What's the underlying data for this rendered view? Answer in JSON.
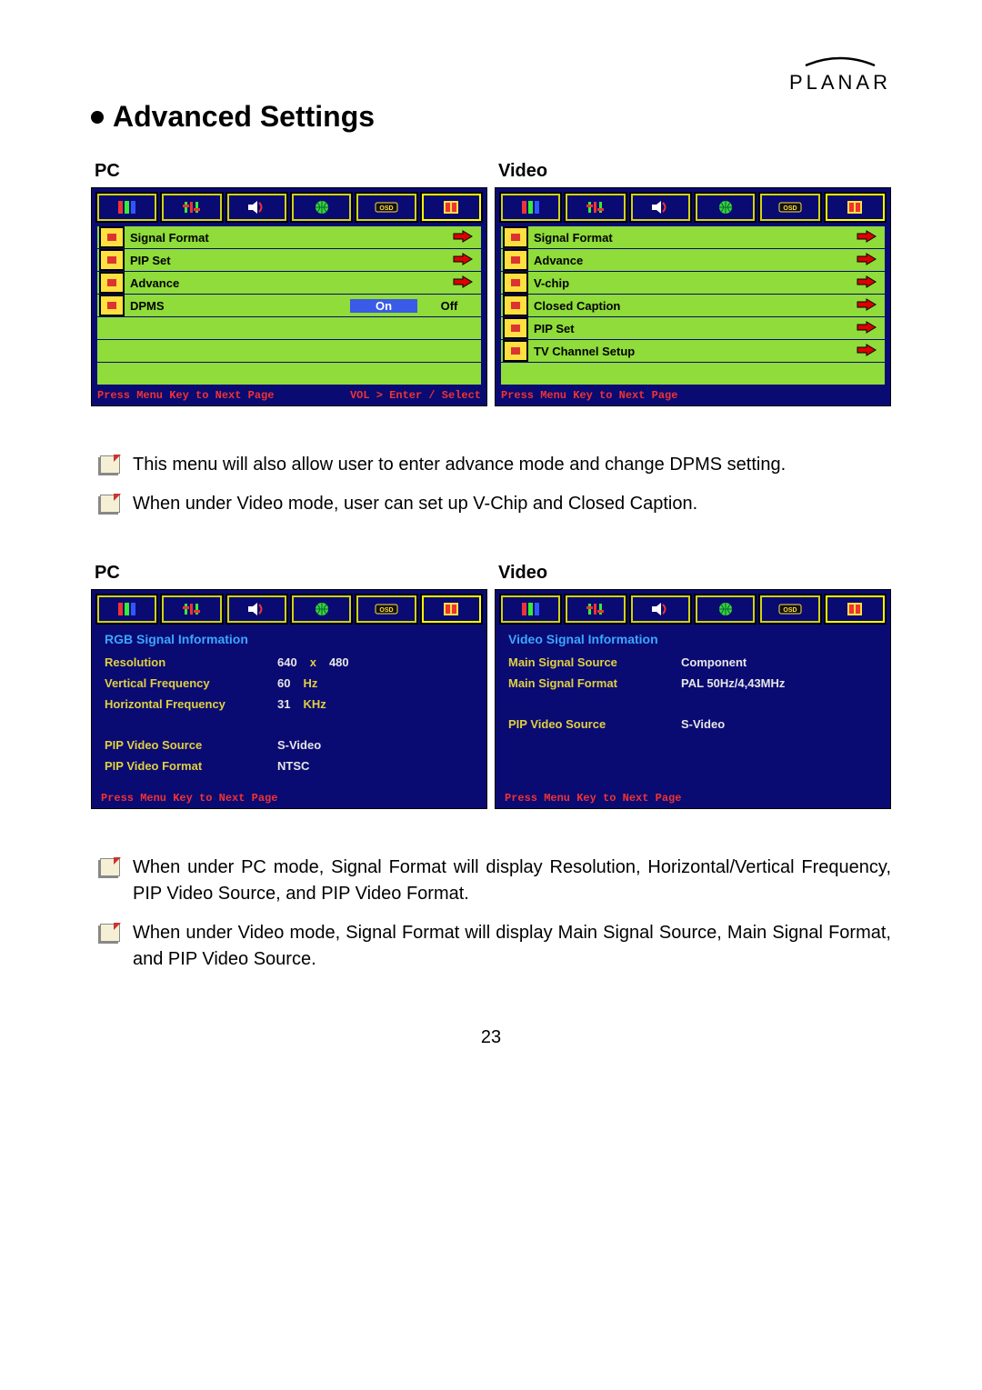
{
  "brand": "PLANAR",
  "title": "Advanced Settings",
  "labels": {
    "pc": "PC",
    "video": "Video"
  },
  "osd": {
    "pc": {
      "rows": [
        {
          "label": "Signal Format",
          "type": "arrow"
        },
        {
          "label": "PIP Set",
          "type": "arrow"
        },
        {
          "label": "Advance",
          "type": "arrow"
        },
        {
          "label": "DPMS",
          "type": "onoff",
          "on": "On",
          "off": "Off"
        }
      ],
      "footer_left": "Press Menu Key to Next Page",
      "footer_right": "VOL > Enter / Select"
    },
    "video": {
      "rows": [
        {
          "label": "Signal Format",
          "type": "arrow"
        },
        {
          "label": "Advance",
          "type": "arrow"
        },
        {
          "label": "V-chip",
          "type": "arrow"
        },
        {
          "label": "Closed Caption",
          "type": "arrow"
        },
        {
          "label": "PIP Set",
          "type": "arrow"
        },
        {
          "label": "TV Channel Setup",
          "type": "arrow"
        }
      ],
      "footer_left": "Press Menu Key to Next Page"
    }
  },
  "notes1": [
    "This menu will also allow user to enter advance mode and change DPMS setting.",
    "When under Video mode, user can set up V-Chip and Closed Caption."
  ],
  "info": {
    "pc": {
      "title": "RGB Signal Information",
      "lines": [
        {
          "k": "Resolution",
          "v": [
            "640",
            "x",
            "480"
          ]
        },
        {
          "k": "Vertical Frequency",
          "v": [
            "60",
            "Hz"
          ]
        },
        {
          "k": "Horizontal Frequency",
          "v": [
            "31",
            "KHz"
          ]
        }
      ],
      "lines2": [
        {
          "k": "PIP Video Source",
          "v": "S-Video"
        },
        {
          "k": "PIP Video Format",
          "v": "NTSC"
        }
      ],
      "footer": "Press Menu Key to Next Page"
    },
    "video": {
      "title": "Video Signal Information",
      "lines": [
        {
          "k": "Main Signal Source",
          "v": "Component"
        },
        {
          "k": "Main Signal Format",
          "v": "PAL 50Hz/4,43MHz"
        }
      ],
      "lines2": [
        {
          "k": "PIP Video Source",
          "v": "S-Video"
        }
      ],
      "footer": "Press Menu Key to Next Page"
    }
  },
  "notes2": [
    "When under PC mode, Signal Format will display Resolution, Horizontal/Vertical Frequency, PIP Video Source, and PIP Video Format.",
    "When under Video mode, Signal Format will display Main Signal Source, Main Signal Format, and PIP Video Source."
  ],
  "page_number": "23",
  "tab_icons": [
    "color-bars",
    "sliders",
    "speaker",
    "globe",
    "osd",
    "tools"
  ]
}
